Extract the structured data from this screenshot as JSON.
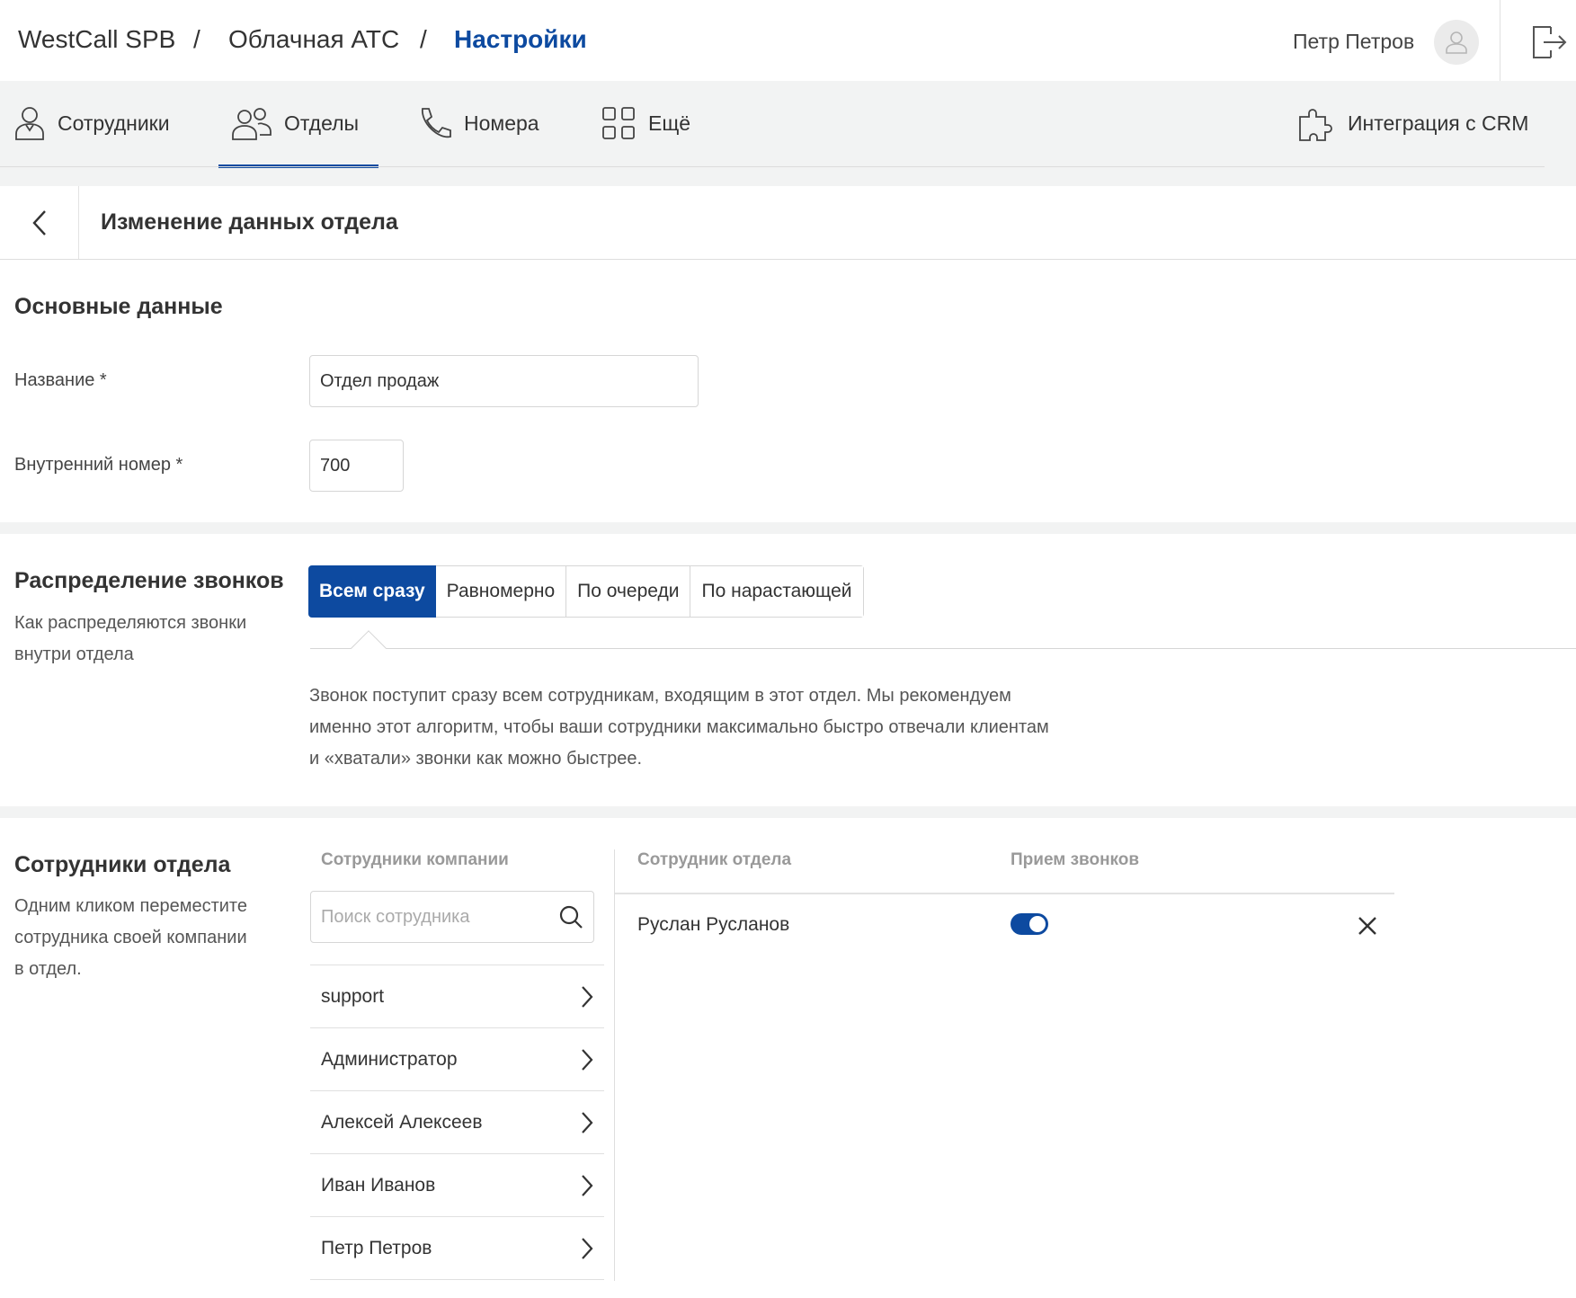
{
  "header": {
    "breadcrumb": [
      "WestCall SPB",
      "Облачная АТС",
      "Настройки"
    ],
    "separator": "/",
    "user_name": "Петр Петров",
    "icons": {
      "avatar": "user-icon",
      "logout": "logout-icon"
    }
  },
  "nav": {
    "items": [
      {
        "label": "Сотрудники",
        "icon": "employee-icon"
      },
      {
        "label": "Отделы",
        "icon": "departments-icon",
        "active": true
      },
      {
        "label": "Номера",
        "icon": "phone-icon"
      },
      {
        "label": "Ещё",
        "icon": "grid-icon"
      }
    ],
    "crm": {
      "label": "Интеграция с CRM",
      "icon": "puzzle-icon"
    }
  },
  "page": {
    "title": "Изменение данных отдела"
  },
  "basic": {
    "title": "Основные данные",
    "name_label": "Название *",
    "name_value": "Отдел продаж",
    "ext_label": "Внутренний номер *",
    "ext_value": "700"
  },
  "distribution": {
    "title": "Распределение звонков",
    "subtitle_line1": "Как распределяются звонки",
    "subtitle_line2": "внутри отдела",
    "options": [
      "Всем сразу",
      "Равномерно",
      "По очереди",
      "По нарастающей"
    ],
    "selected": "Всем сразу",
    "description_line1": "Звонок поступит сразу всем сотрудникам, входящим в этот отдел. Мы рекомендуем",
    "description_line2": "именно этот алгоритм, чтобы ваши сотрудники максимально быстро отвечали клиентам",
    "description_line3": "и «хватали» звонки как можно быстрее."
  },
  "employees": {
    "title": "Сотрудники отдела",
    "subtitle_line1": "Одним кликом переместите",
    "subtitle_line2": "сотрудника своей компании",
    "subtitle_line3": "в отдел.",
    "company_header": "Сотрудники компании",
    "search_placeholder": "Поиск сотрудника",
    "company_list": [
      "support",
      "Администратор",
      "Алексей Алексеев",
      "Иван Иванов",
      "Петр Петров"
    ],
    "dept_header": "Сотрудник отдела",
    "calls_header": "Прием звонков",
    "dept_members": [
      {
        "name": "Руслан Русланов",
        "receiving_calls": true
      }
    ]
  },
  "colors": {
    "accent": "#0d4aa0",
    "background": "#f2f3f3"
  }
}
